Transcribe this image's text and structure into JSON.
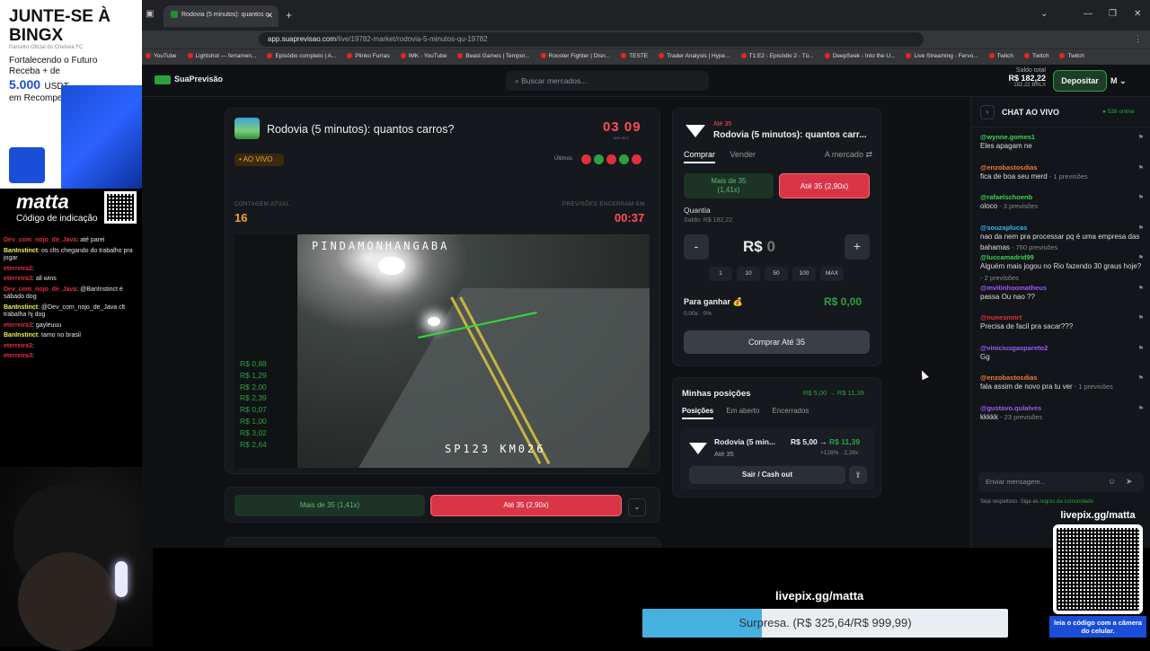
{
  "ad": {
    "headline": "JUNTE-SE À BINGX",
    "partner": "Parceiro Oficial do Chelsea FC",
    "line1": "Fortalecendo o Futuro",
    "line2": "Receba + de",
    "amount": "5.000",
    "unit": "USDT",
    "line3": "em Recompensas"
  },
  "matta": {
    "name": "matta",
    "code": "Código de indicação"
  },
  "twitch_chat": [
    {
      "user": "Dev_com_nojo_de_Java",
      "text": "até parei",
      "color": "#e0303d"
    },
    {
      "user": "BanInstinct",
      "text": "os clts chegando do trabalho pra jogar",
      "color": "#f3f34a"
    },
    {
      "user": "eterreira2",
      "text": "",
      "color": "#e0303d"
    },
    {
      "user": "eterreira3",
      "text": "all wins",
      "color": "#e0303d"
    },
    {
      "user": "Dev_com_nojo_de_Java",
      "text": "@BanInstinct é sábado dog",
      "color": "#e0303d"
    },
    {
      "user": "BanInstinct",
      "text": "@Dev_com_nojo_de_Java clt trabalha hj dog",
      "color": "#f3f34a"
    },
    {
      "user": "eterreira3",
      "text": "gayleuuu",
      "color": "#e0303d"
    },
    {
      "user": "BanInstinct",
      "text": "tamo no brasil",
      "color": "#f3f34a"
    },
    {
      "user": "eterreira3",
      "text": "",
      "color": "#e0303d"
    },
    {
      "user": "eterreira3",
      "text": "",
      "color": "#e0303d"
    }
  ],
  "browser": {
    "tab_title": "Rodovia (5 minutos): quantos c",
    "url_host": "app.suaprevisao.com",
    "url_path": "/live/19782-market/rodovia-5-minutos-qu-19782",
    "bookmarks": [
      "YouTube",
      "Lightshot — ferramen...",
      "Episódio completo | A...",
      "Plinko Furras",
      "IMK - YouTube",
      "Beast Games | Tempor...",
      "Rooster Fighter | Disn...",
      "TESTE",
      "Trader Analysis | Hype...",
      "T1:E2 - Episódio 2 - Tú...",
      "DeepSeek - Into the U...",
      "Live Streaming - Fervo...",
      "Twitch",
      "Twitch",
      "Twitch"
    ]
  },
  "site": {
    "brand": "SuaPrevisão",
    "search_placeholder": "Buscar mercados...",
    "saldo_label": "Saldo total",
    "saldo_value": "R$ 182,22",
    "saldo_sub": "182.22 BRLX",
    "deposit_label": "Depositar",
    "avatar": "M"
  },
  "market": {
    "title": "Rodovia (5 minutos): quantos carros?",
    "timer": "03 09",
    "timer_labels": "MIN   SEG",
    "status": "• AO VIVO",
    "last_label": "Últimos",
    "last_results": [
      "r",
      "g",
      "r",
      "g",
      "r"
    ],
    "count_label": "CONTAGEM ATUAL",
    "count_value": "16",
    "closes_label": "PREVISÕES ENCERRAM EM",
    "closes_value": "00:37",
    "cam_top": "PINDAMONHANGABA",
    "cam_bottom": "SP123 KM026",
    "odds": [
      "R$ 0,88",
      "R$ 1,29",
      "R$ 2,00",
      "R$ 2,39",
      "R$ 0,07",
      "R$ 1,00",
      "R$ 3,02",
      "R$ 2,64"
    ],
    "btn_mais": "Mais de 35 (1,41x)",
    "btn_ate": "Até 35 (2,90x)"
  },
  "trade": {
    "sub": "Até 35",
    "title": "Rodovia (5 minutos): quantos carr...",
    "tab_buy": "Comprar",
    "tab_sell": "Vender",
    "mode": "A mercado ⇄",
    "opt_mais_line1": "Mais de 35",
    "opt_mais_line2": "(1,41x)",
    "opt_ate": "Até 35 (2,90x)",
    "qty_label": "Quantia",
    "saldo": "Saldo: R$ 182,22",
    "minus": "-",
    "plus": "+",
    "currency": "R$",
    "amount": "0",
    "presets": [
      "1",
      "10",
      "50",
      "100",
      "MAX"
    ],
    "win_label": "Para ganhar 💰",
    "win_sub": "0,00x · 0%",
    "win_value": "R$ 0,00",
    "buy_button": "Comprar Até 35"
  },
  "positions": {
    "title": "Minhas posições",
    "delta": "R$ 5,00 → R$ 11,39",
    "tabs": [
      "Posições",
      "Em aberto",
      "Encerrados"
    ],
    "item_name": "Rodovia (5 min...",
    "item_side": "Até 35",
    "item_from": "R$ 5,00 →",
    "item_to": "R$ 11,39",
    "item_pct": "+128% · 2,28x",
    "cashout": "Sair / Cash out",
    "share_icon": "⇪"
  },
  "chat": {
    "title": "CHAT AO VIVO",
    "online": "● 538 online",
    "messages": [
      {
        "user": "@wynne.gomes1",
        "text": "Eles apagam ne",
        "pv": "",
        "color": "#3fcf5a"
      },
      {
        "user": "@enzobastosdias",
        "text": "fica de boa seu merd",
        "pv": " - 1 previsões",
        "color": "#f07a34"
      },
      {
        "user": "@rafaelschoenb",
        "text": "oloco",
        "pv": " - 3 previsões",
        "color": "#3fcf5a"
      },
      {
        "user": "@souzaplucas",
        "text": "nao da nem pra processar pq é uma empresa das bahamas",
        "pv": " - 760 previsões",
        "color": "#38b6e8"
      },
      {
        "user": "@luccamadrid99",
        "text": "Alguém mais jogou no Rio fazendo 30 graus hoje?",
        "pv": " - 2 previsões",
        "color": "#3fcf5a"
      },
      {
        "user": "@mvitinhoomatheus",
        "text": "passa Ou nao ??",
        "pv": "",
        "color": "#9b5cf0"
      },
      {
        "user": "@nunesmnrt",
        "text": "Precisa de facil pra sacar???",
        "pv": "",
        "color": "#e0303d"
      },
      {
        "user": "@viniciusgaspareto2",
        "text": "Gg",
        "pv": "",
        "color": "#9b5cf0"
      },
      {
        "user": "@enzobastosdias",
        "text": "fala assim de novo pra tu ver",
        "pv": " - 1 previsões",
        "color": "#f07a34"
      },
      {
        "user": "@gustavo.qulalves",
        "text": "kkkkk",
        "pv": " - 23 previsões",
        "color": "#9b5cf0"
      }
    ],
    "input_placeholder": "Enviar mensagem...",
    "rules_pre": "Seja respeitoso. Siga as ",
    "rules_link": "regras da comunidade"
  },
  "overlay": {
    "livepix_right": "livepix.gg/matta",
    "qr_caption": "leia o código com a câmera do celular.",
    "goal_label": "livepix.gg/matta",
    "goal_text": "Surpresa. (R$ 325,64/R$ 999,99)",
    "goal_progress": 0.3256
  }
}
